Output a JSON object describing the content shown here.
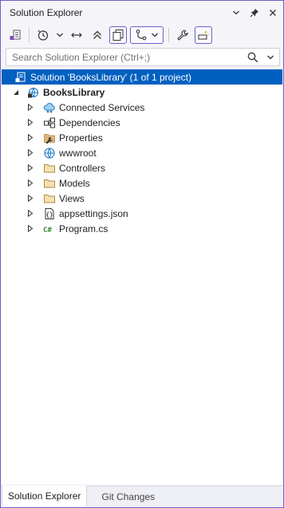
{
  "window": {
    "title": "Solution Explorer"
  },
  "search": {
    "placeholder": "Search Solution Explorer (Ctrl+;)"
  },
  "tree": [
    {
      "label": "Solution 'BooksLibrary' (1 of 1 project)",
      "icon": "solution-icon",
      "selected": true,
      "expander": "none",
      "bold": false
    },
    {
      "label": "BooksLibrary",
      "icon": "web-project-icon",
      "selected": false,
      "expander": "expanded",
      "bold": true
    },
    {
      "label": "Connected Services",
      "icon": "connected-services-icon",
      "selected": false,
      "expander": "collapsed",
      "bold": false
    },
    {
      "label": "Dependencies",
      "icon": "dependencies-icon",
      "selected": false,
      "expander": "collapsed",
      "bold": false
    },
    {
      "label": "Properties",
      "icon": "properties-wrench-icon",
      "selected": false,
      "expander": "collapsed",
      "bold": false
    },
    {
      "label": "wwwroot",
      "icon": "globe-icon",
      "selected": false,
      "expander": "collapsed",
      "bold": false
    },
    {
      "label": "Controllers",
      "icon": "folder-icon",
      "selected": false,
      "expander": "collapsed",
      "bold": false
    },
    {
      "label": "Models",
      "icon": "folder-icon",
      "selected": false,
      "expander": "collapsed",
      "bold": false
    },
    {
      "label": "Views",
      "icon": "folder-icon",
      "selected": false,
      "expander": "collapsed",
      "bold": false
    },
    {
      "label": "appsettings.json",
      "icon": "json-file-icon",
      "selected": false,
      "expander": "collapsed",
      "bold": false
    },
    {
      "label": "Program.cs",
      "icon": "csharp-file-icon",
      "selected": false,
      "expander": "collapsed",
      "bold": false
    }
  ],
  "tabs": [
    {
      "label": "Solution Explorer",
      "active": true
    },
    {
      "label": "Git Changes",
      "active": false
    }
  ],
  "colors": {
    "accent": "#6b5fc7",
    "selection": "#0060c0",
    "folder": "#dcb67a"
  }
}
